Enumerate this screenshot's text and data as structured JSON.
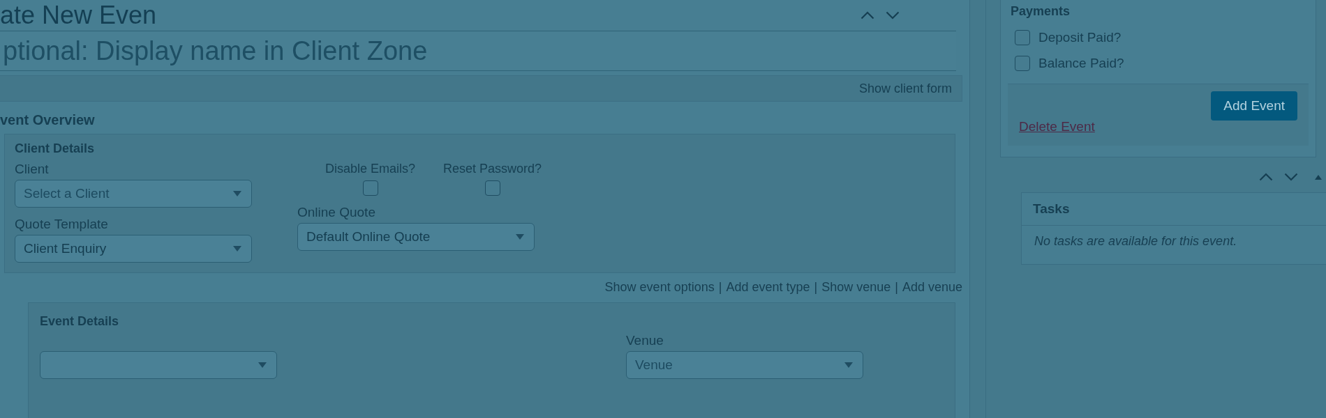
{
  "page_title": "ate New Even",
  "display_name": {
    "placeholder": "ptional: Display name in Client Zone"
  },
  "client_form": {
    "link": "Show client form"
  },
  "event_overview": {
    "title": "vent Overview",
    "client_details": {
      "title": "Client Details",
      "columns": [
        {
          "fields": [
            {
              "kind": "select",
              "label": "Client",
              "placeholder": "Select a Client"
            },
            {
              "kind": "select",
              "label": "Quote Template",
              "value": "Client Enquiry"
            }
          ]
        },
        {
          "checkboxes": [
            {
              "label": "Disable Emails?",
              "checked": false
            },
            {
              "label": "Reset Password?",
              "checked": false
            }
          ],
          "fields": [
            {
              "kind": "select",
              "label": "Online Quote",
              "value": "Default Online Quote"
            }
          ]
        }
      ]
    },
    "links": [
      {
        "label": "Show event options",
        "separator": "|"
      },
      {
        "label": "Add event type",
        "separator": "|"
      },
      {
        "label": "Show venue",
        "separator": "|"
      },
      {
        "label": "Add venue"
      }
    ],
    "event_details": {
      "title": "Event Details",
      "fields": [
        {
          "kind": "select"
        },
        {
          "kind": "select",
          "label": "Venue",
          "placeholder": "Venue"
        }
      ]
    }
  },
  "payments": {
    "title": "Payments",
    "checkboxes": [
      {
        "label": "Deposit Paid?",
        "checked": false
      },
      {
        "label": "Balance Paid?",
        "checked": false
      }
    ],
    "delete_link": "Delete Event",
    "submit_button": "Add Event"
  },
  "tasks": {
    "title": "Tasks",
    "message": "No tasks are available for this event."
  }
}
